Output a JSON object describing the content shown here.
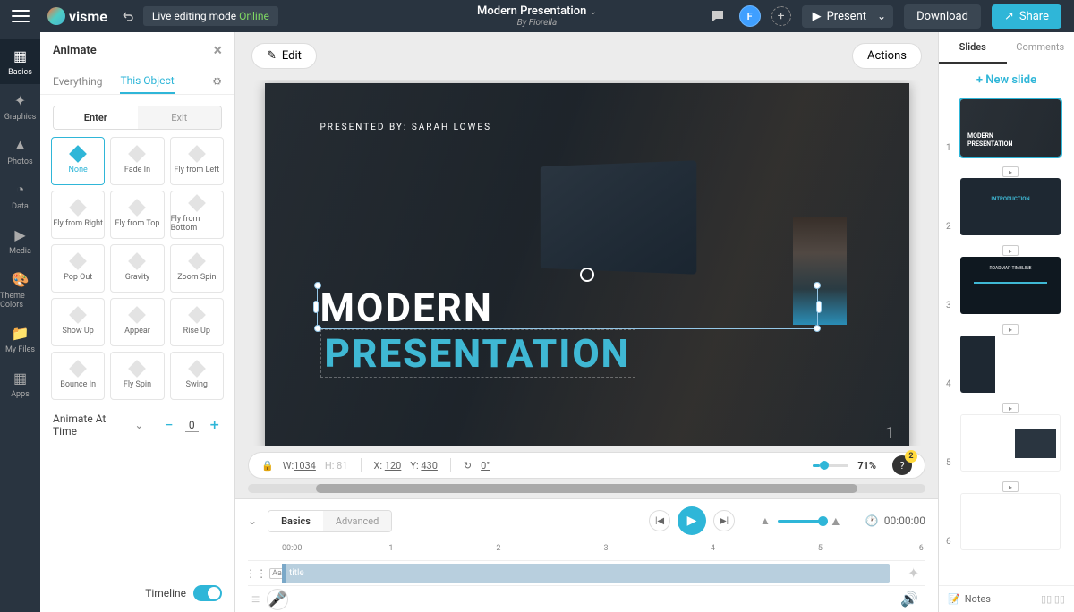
{
  "top": {
    "logo": "visme",
    "edit_mode": "Live editing mode",
    "online": "Online",
    "title": "Modern Presentation",
    "author": "By Fiorella",
    "avatar_letter": "F",
    "present": "Present",
    "download": "Download",
    "share": "Share"
  },
  "rail": [
    {
      "label": "Basics"
    },
    {
      "label": "Graphics"
    },
    {
      "label": "Photos"
    },
    {
      "label": "Data"
    },
    {
      "label": "Media"
    },
    {
      "label": "Theme Colors"
    },
    {
      "label": "My Files"
    },
    {
      "label": "Apps"
    }
  ],
  "panel": {
    "title": "Animate",
    "tabs": {
      "everything": "Everything",
      "this": "This Object"
    },
    "enter": "Enter",
    "exit": "Exit",
    "anims": [
      "None",
      "Fade In",
      "Fly from Left",
      "Fly from Right",
      "Fly from Top",
      "Fly from Bottom",
      "Pop Out",
      "Gravity",
      "Zoom Spin",
      "Show Up",
      "Appear",
      "Rise Up",
      "Bounce In",
      "Fly Spin",
      "Swing"
    ],
    "time_label": "Animate At Time",
    "time_value": "0",
    "footer": "Timeline"
  },
  "edit_btn": "Edit",
  "actions_btn": "Actions",
  "canvas": {
    "presented": "PRESENTED BY: SARAH LOWES",
    "title1": "MODERN",
    "title2": "PRESENTATION",
    "page": "1"
  },
  "status": {
    "w_label": "W:",
    "w": "1034",
    "h_label": "H:",
    "h": "81",
    "x_label": "X:",
    "x": "120",
    "y_label": "Y:",
    "y": "430",
    "deg": "0°",
    "zoom": "71%",
    "badge": "2"
  },
  "timeline": {
    "basics": "Basics",
    "advanced": "Advanced",
    "ticks": [
      "00:00",
      "1",
      "2",
      "3",
      "4",
      "5",
      "6"
    ],
    "row_label": "title",
    "time": "00:00:00"
  },
  "right": {
    "slides": "Slides",
    "comments": "Comments",
    "new": "+ New slide",
    "thumbs": [
      "1",
      "2",
      "3",
      "4",
      "5",
      "6"
    ],
    "notes": "Notes"
  }
}
